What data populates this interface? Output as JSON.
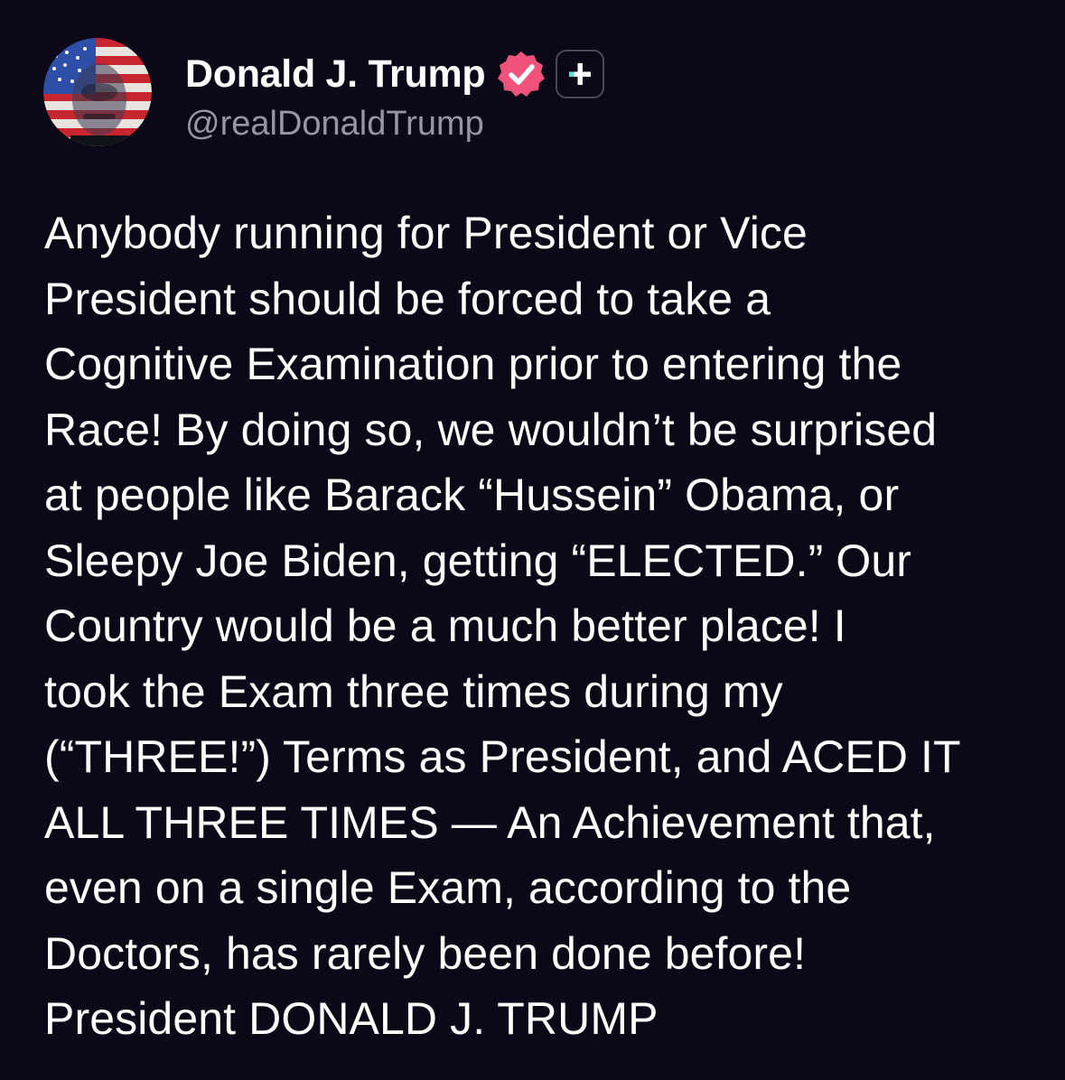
{
  "post": {
    "author": {
      "display_name": "Donald J. Trump",
      "handle": "@realDonaldTrump",
      "verified": true,
      "avatar_icon": "avatar-flag-portrait-icon",
      "badges": [
        "verified-badge-icon",
        "plus-badge-icon"
      ]
    },
    "body_lines": [
      "Anybody running for President or Vice",
      "President should be forced to take a",
      "Cognitive Examination prior to entering the",
      "Race! By doing so, we wouldn’t be surprised",
      "at people like Barack “Hussein” Obama, or",
      "Sleepy Joe Biden, getting “ELECTED.” Our",
      "Country would be a much better place! I",
      "took the Exam three times during my",
      "(“THREE!”) Terms as President, and ACED IT",
      "ALL THREE TIMES — An Achievement that,",
      "even on a single Exam, according to the",
      "Doctors, has rarely been done before!",
      "President DONALD J. TRUMP"
    ]
  },
  "colors": {
    "background": "#0b0817",
    "text": "#ffffff",
    "handle": "#9795a4",
    "verified": "#f0527a",
    "plus_accent": "#5be0d4"
  }
}
